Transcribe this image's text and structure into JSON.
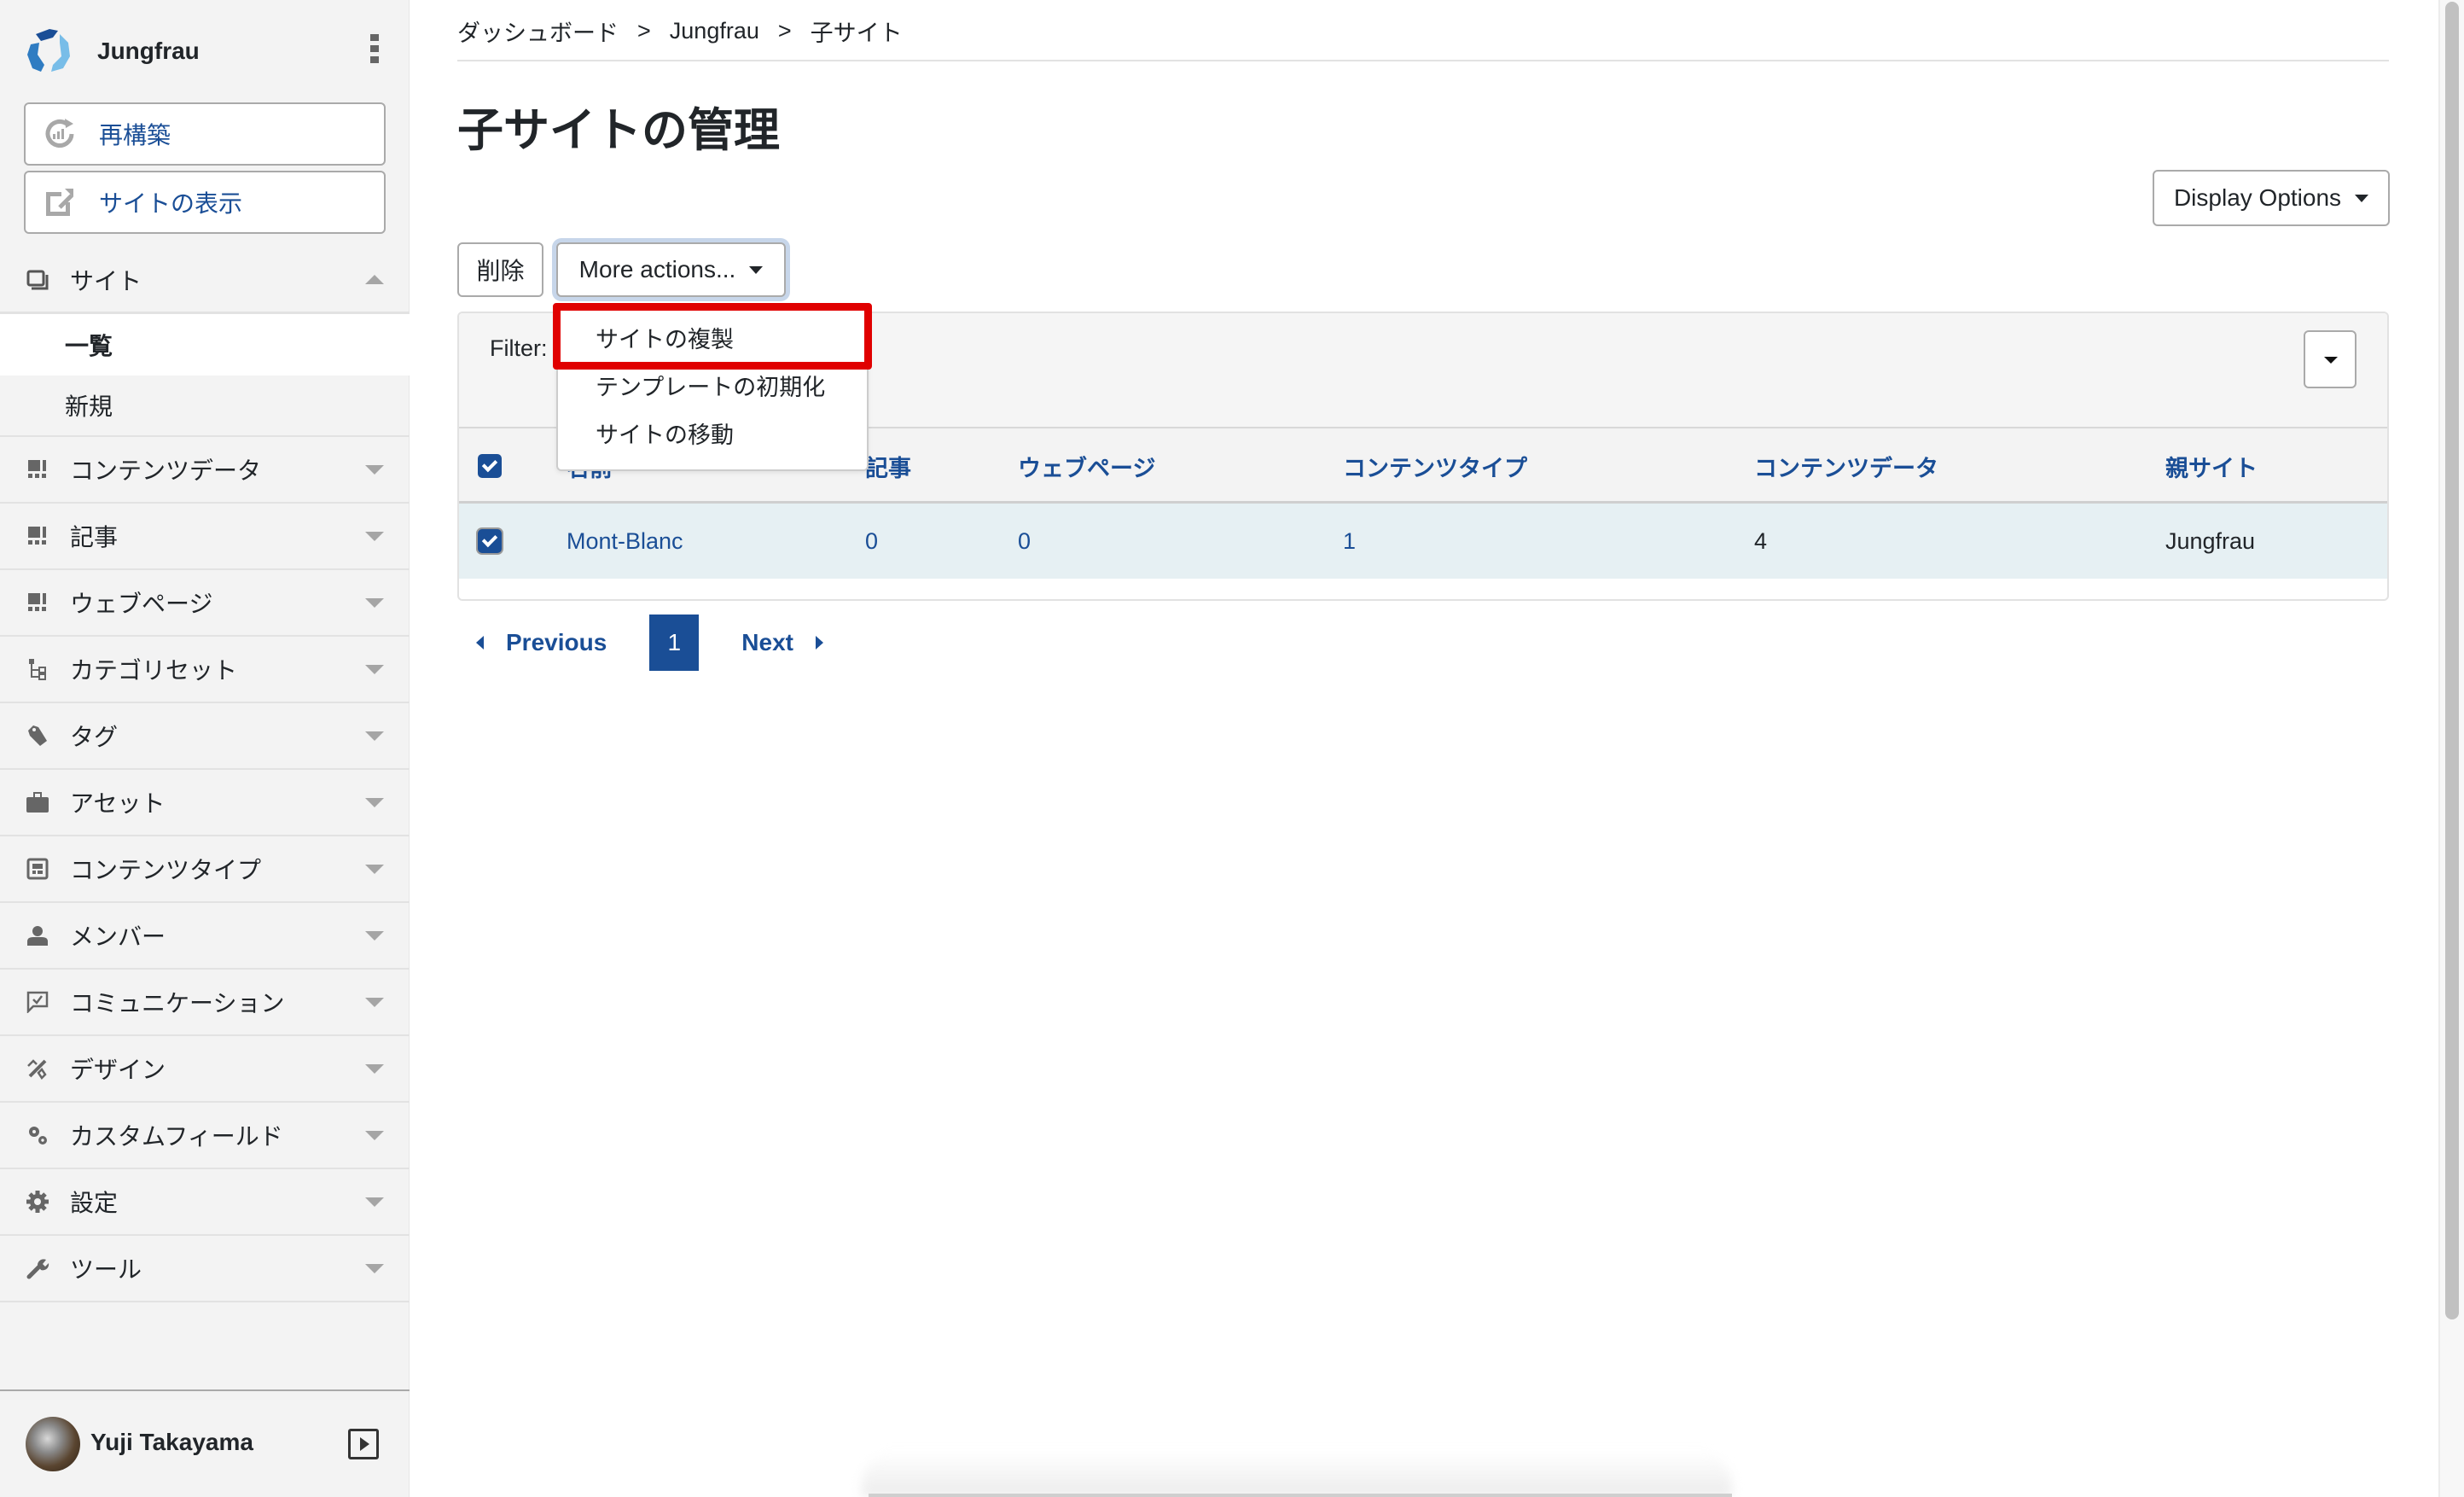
{
  "sidebar": {
    "site_name": "Jungfrau",
    "rebuild_label": "再構築",
    "view_site_label": "サイトの表示",
    "nav": [
      {
        "label": "サイト",
        "icon": "site-icon",
        "expanded": true
      },
      {
        "label": "コンテンツデータ",
        "icon": "content-data-icon"
      },
      {
        "label": "記事",
        "icon": "entry-icon"
      },
      {
        "label": "ウェブページ",
        "icon": "webpage-icon"
      },
      {
        "label": "カテゴリセット",
        "icon": "category-set-icon"
      },
      {
        "label": "タグ",
        "icon": "tag-icon"
      },
      {
        "label": "アセット",
        "icon": "asset-icon"
      },
      {
        "label": "コンテンツタイプ",
        "icon": "content-type-icon"
      },
      {
        "label": "メンバー",
        "icon": "member-icon"
      },
      {
        "label": "コミュニケーション",
        "icon": "communication-icon"
      },
      {
        "label": "デザイン",
        "icon": "design-icon"
      },
      {
        "label": "カスタムフィールド",
        "icon": "custom-field-icon"
      },
      {
        "label": "設定",
        "icon": "settings-icon"
      },
      {
        "label": "ツール",
        "icon": "tools-icon"
      }
    ],
    "site_sub": [
      {
        "label": "一覧",
        "active": true
      },
      {
        "label": "新規",
        "active": false
      }
    ],
    "user_name": "Yuji Takayama"
  },
  "breadcrumb": [
    {
      "label": "ダッシュボード"
    },
    {
      "label": "Jungfrau"
    },
    {
      "label": "子サイト"
    }
  ],
  "breadcrumb_sep": ">",
  "page_title": "子サイトの管理",
  "toolbar": {
    "display_options_label": "Display Options",
    "delete_label": "削除",
    "more_actions_label": "More actions..."
  },
  "more_actions_menu": {
    "items": [
      {
        "label": "サイトの複製",
        "highlighted": true
      },
      {
        "label": "テンプレートの初期化",
        "highlighted": false
      },
      {
        "label": "サイトの移動",
        "highlighted": false
      }
    ]
  },
  "filter": {
    "label": "Filter:"
  },
  "table": {
    "columns": [
      "名前",
      "記事",
      "ウェブページ",
      "コンテンツタイプ",
      "コンテンツデータ",
      "親サイト"
    ],
    "rows": [
      {
        "checked": true,
        "name": "Mont-Blanc",
        "entries": "0",
        "pages": "0",
        "content_types": "1",
        "content_data": "4",
        "parent": "Jungfrau"
      }
    ],
    "select_all_checked": true
  },
  "pagination": {
    "previous_label": "Previous",
    "next_label": "Next",
    "current_page": "1"
  },
  "scrollbar": {
    "visible_fraction": 0.88
  },
  "colors": {
    "link": "#1a4e96",
    "highlight_box": "#e00000",
    "row_selected": "#e6f0f3",
    "sidebar_bg": "#f3f3f3"
  }
}
